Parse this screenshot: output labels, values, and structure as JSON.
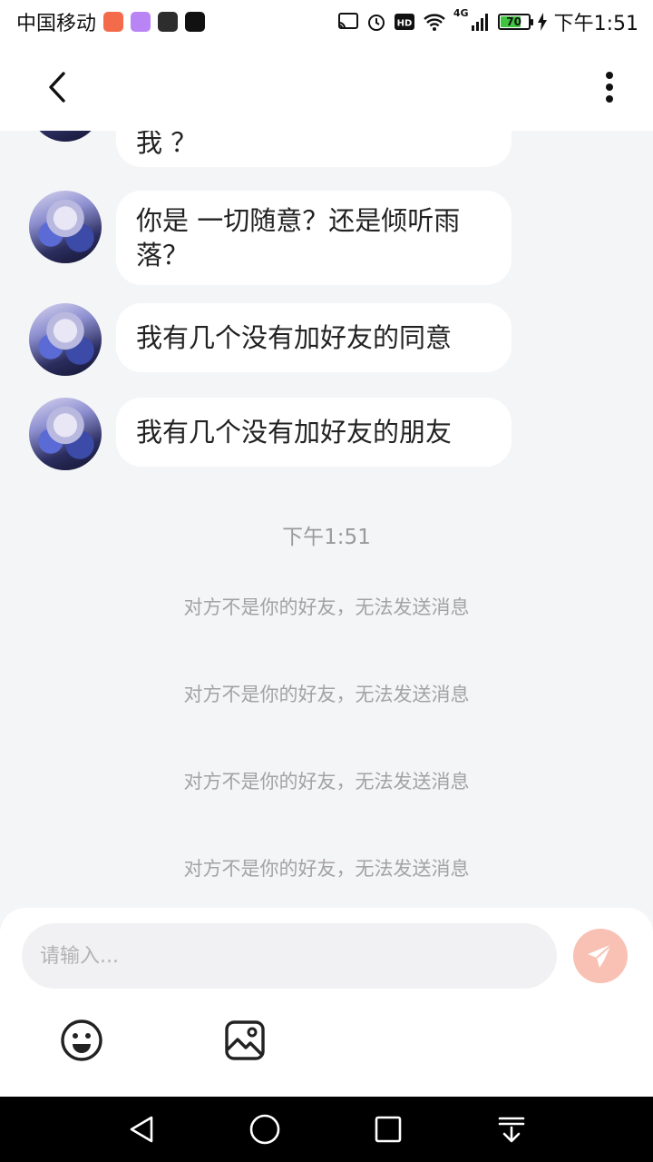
{
  "status_bar": {
    "carrier": "中国移动",
    "battery_level": "70",
    "time": "下午1:51",
    "network": "4G"
  },
  "header": {
    "back_icon": "chevron-left-icon",
    "more_icon": "more-vertical-icon"
  },
  "messages": [
    {
      "text": "我 ？"
    },
    {
      "text": "你是 一切随意？还是倾听雨落？"
    },
    {
      "text": "我有几个没有加好友的同意"
    },
    {
      "text": "我有几个没有加好友的朋友"
    }
  ],
  "timestamp": "下午1:51",
  "system_notices": [
    "对方不是你的好友，无法发送消息",
    "对方不是你的好友，无法发送消息",
    "对方不是你的好友，无法发送消息",
    "对方不是你的好友，无法发送消息"
  ],
  "composer": {
    "placeholder": "请输入...",
    "value": "",
    "send_icon": "paper-plane-icon",
    "emoji_icon": "smiley-icon",
    "image_icon": "image-icon",
    "send_color": "#f8c1b4"
  },
  "nav_bar": {
    "icons": [
      "back-triangle-icon",
      "home-circle-icon",
      "recents-square-icon",
      "download-arrow-icon"
    ]
  }
}
